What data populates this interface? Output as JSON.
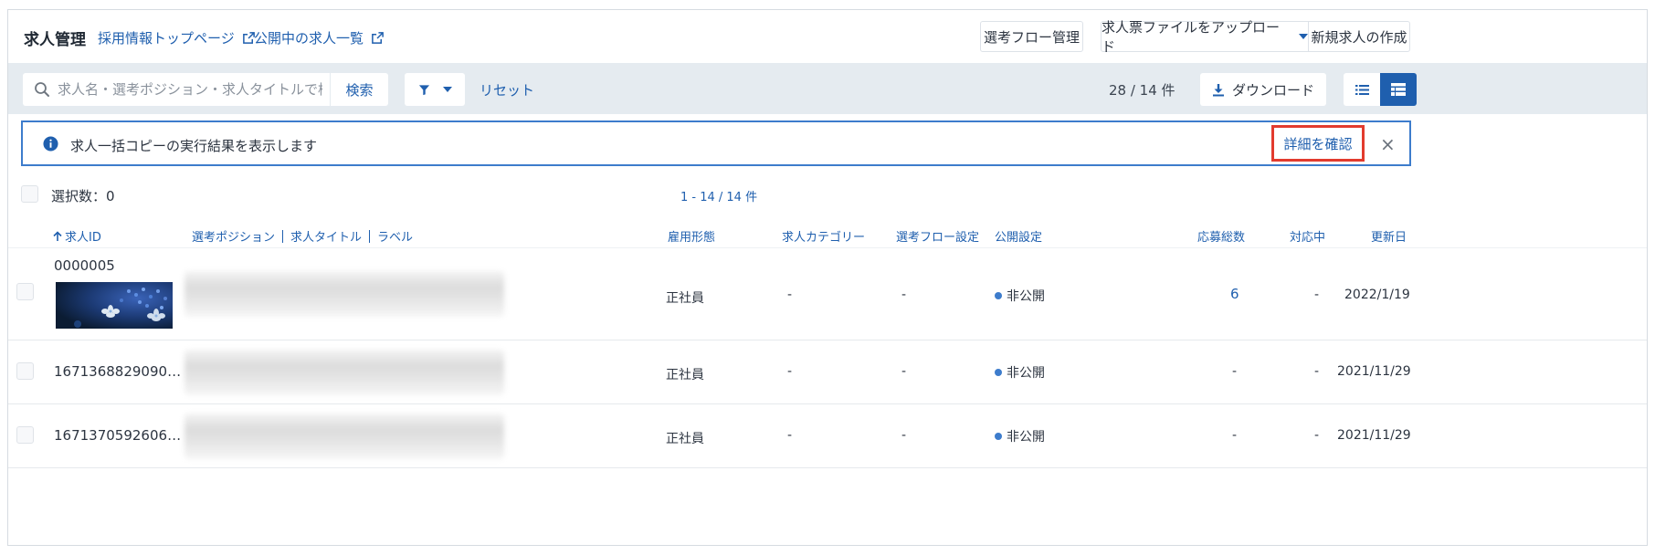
{
  "header": {
    "title": "求人管理",
    "links": [
      {
        "label": "採用情報トップページ"
      },
      {
        "label": "公開中の求人一覧"
      }
    ],
    "buttons": {
      "flow": "選考フロー管理",
      "upload": "求人票ファイルをアップロード",
      "create": "新規求人の作成"
    }
  },
  "toolbar": {
    "search_placeholder": "求人名・選考ポジション・求人タイトルで検索",
    "search_button": "検索",
    "reset": "リセット",
    "count": "28 / 14 件",
    "download": "ダウンロード"
  },
  "notice": {
    "text": "求人一括コピーの実行結果を表示します",
    "detail_button": "詳細を確認",
    "close": "×"
  },
  "selection": {
    "label": "選択数：0",
    "range": "1 - 14 / 14 件"
  },
  "table": {
    "columns": {
      "id": "求人ID",
      "position": "選考ポジション",
      "title": "求人タイトル",
      "label": "ラベル",
      "employment": "雇用形態",
      "category": "求人カテゴリー",
      "flow": "選考フロー設定",
      "publish": "公開設定",
      "applicants": "応募総数",
      "in_progress": "対応中",
      "updated": "更新日"
    },
    "rows": [
      {
        "id": "0000005",
        "employment": "正社員",
        "category": "-",
        "flow": "-",
        "publish": "非公開",
        "applicants": "6",
        "in_progress": "-",
        "updated": "2022/1/19"
      },
      {
        "id": "1671368829090…",
        "employment": "正社員",
        "category": "-",
        "flow": "-",
        "publish": "非公開",
        "applicants": "-",
        "in_progress": "-",
        "updated": "2021/11/29"
      },
      {
        "id": "1671370592606…",
        "employment": "正社員",
        "category": "-",
        "flow": "-",
        "publish": "非公開",
        "applicants": "-",
        "in_progress": "-",
        "updated": "2021/11/29"
      }
    ]
  },
  "colors": {
    "accent": "#1f5fae",
    "toolbar_bg": "#e5ebf0",
    "highlight_border": "#e23b2e",
    "notice_border": "#3d7ccc"
  }
}
